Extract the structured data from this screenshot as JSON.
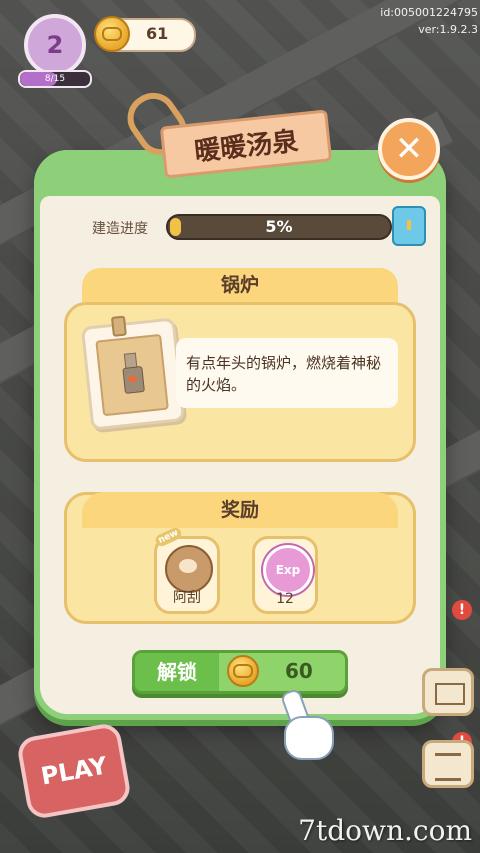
{
  "hud": {
    "level": "2",
    "level_progress_text": "8/15",
    "level_progress_fraction": 0.533,
    "coins": "61",
    "id_text": "id:005001224795",
    "version_text": "ver:1.9.2.3"
  },
  "modal": {
    "title": "暖暖汤泉",
    "progress_label": "建造进度",
    "progress_percent": 5,
    "progress_text": "5%",
    "item_section_title": "锅炉",
    "item_description": "有点年头的锅炉，燃烧着神秘的火焰。",
    "reward_section_title": "奖励",
    "rewards": [
      {
        "label": "阿刮",
        "icon": "cat-character-icon",
        "badge": "new"
      },
      {
        "label": "12",
        "icon": "exp-star-icon",
        "icon_text": "Exp"
      }
    ],
    "unlock_label": "解锁",
    "unlock_price": "60"
  },
  "side": {
    "play_label": "PLAY",
    "alert_mark": "!"
  },
  "watermark": "7tdown.com",
  "colors": {
    "modal_border": "#8ed07a",
    "section_bg": "#fbe5a3",
    "title_banner": "#f7c9a3",
    "close_button": "#f3a55b",
    "unlock_button": "#8fd36b",
    "progress_fill": "#f2c246"
  }
}
